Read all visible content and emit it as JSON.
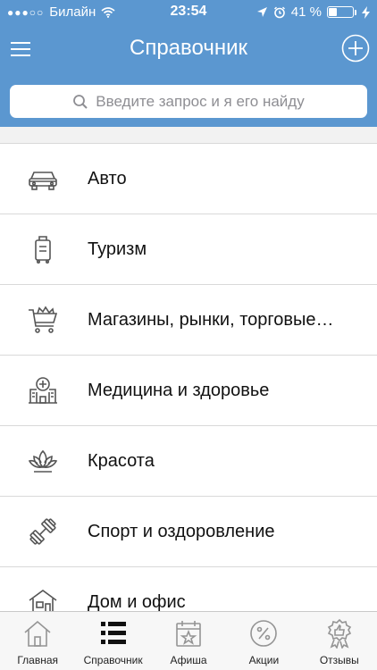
{
  "status_bar": {
    "carrier": "Билайн",
    "time": "23:54",
    "battery_percent": "41 %",
    "battery_level": 0.41
  },
  "header": {
    "title": "Справочник",
    "background_color": "#5b97d0"
  },
  "search": {
    "placeholder": "Введите запрос и я его найду"
  },
  "categories": [
    {
      "label": "Авто",
      "icon": "car-icon"
    },
    {
      "label": "Туризм",
      "icon": "suitcase-icon"
    },
    {
      "label": "Магазины, рынки, торговые…",
      "icon": "shopping-cart-icon"
    },
    {
      "label": "Медицина и здоровье",
      "icon": "hospital-icon"
    },
    {
      "label": "Красота",
      "icon": "lotus-icon"
    },
    {
      "label": "Спорт и оздоровление",
      "icon": "dumbbell-icon"
    },
    {
      "label": "Дом и офис",
      "icon": "house-icon"
    }
  ],
  "tab_bar": [
    {
      "label": "Главная",
      "icon": "home-icon",
      "active": false
    },
    {
      "label": "Справочник",
      "icon": "list-icon",
      "active": true
    },
    {
      "label": "Афиша",
      "icon": "calendar-star-icon",
      "active": false
    },
    {
      "label": "Акции",
      "icon": "percent-icon",
      "active": false
    },
    {
      "label": "Отзывы",
      "icon": "award-thumb-icon",
      "active": false
    }
  ]
}
